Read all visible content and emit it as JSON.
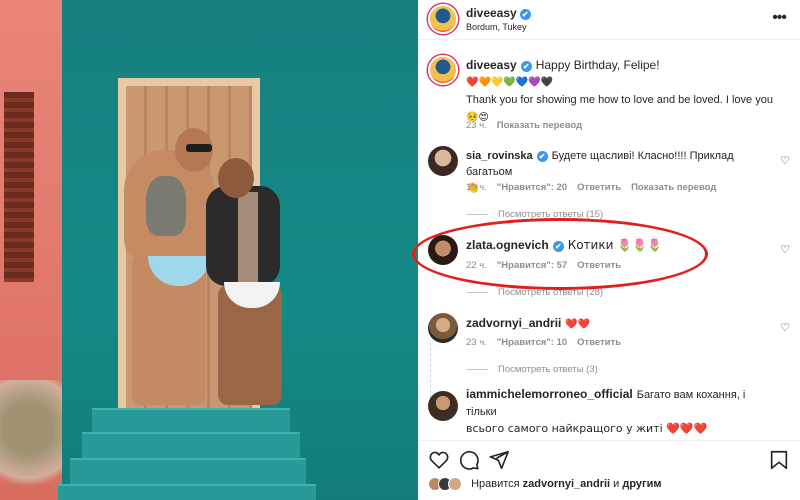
{
  "post": {
    "owner": "diveeasy",
    "location": "Bordum, Tukey",
    "verified_mark": "✔"
  },
  "caption": {
    "username": "diveeasy",
    "line1": "Happy Birthday, Felipe!",
    "hearts": "❤️🧡💛💚💙💜🖤",
    "line2": "Thank you for showing me how to love and be loved. I love you",
    "line3": "🥺😍",
    "time": "23 ч.",
    "translate": "Показать перевод"
  },
  "comments": [
    {
      "username": "sia_rovinska",
      "text": "Будете щасливі! Класно!!!! Приклад багатьом",
      "text2": "👏",
      "time": "19 ч.",
      "likes": "\"Нравится\": 20",
      "reply": "Ответить",
      "translate": "Показать перевод",
      "replies": "Посмотреть ответы (15)"
    },
    {
      "username": "zlata.ognevich",
      "text": "Котики 🌷🌷🌷",
      "time": "22 ч.",
      "likes": "\"Нравится\": 57",
      "reply": "Ответить",
      "replies": "Посмотреть ответы (28)"
    },
    {
      "username": "zadvornyi_andrii",
      "text": "❤️❤️",
      "time": "23 ч.",
      "likes": "\"Нравится\": 10",
      "reply": "Ответить",
      "replies": "Посмотреть ответы (3)"
    },
    {
      "username": "iammichelemorroneo_official",
      "text": "Багато вам кохання, і тільки",
      "text2": "всього самого найкращого у житі ❤️❤️❤️"
    }
  ],
  "likes_bar": {
    "prefix": "Нравится",
    "user": "zadvornyi_andrii",
    "middle": "и",
    "suffix": "другим"
  },
  "colors": {
    "verified": "#3897f0",
    "highlight": "#e1201e",
    "muted": "#8e8e8e"
  }
}
